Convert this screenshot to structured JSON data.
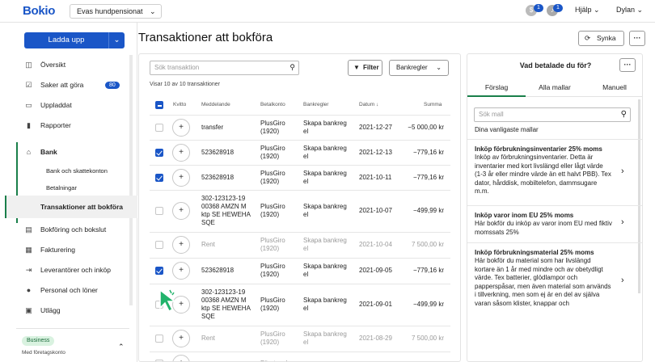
{
  "topbar": {
    "logo": "Bokio",
    "company": "Evas hundpensionat",
    "chev": "⌄",
    "badge1": "1",
    "badge2": "1",
    "help": "Hjälp ⌄",
    "user": "Dylan ⌄"
  },
  "sidebar": {
    "upload": "Ladda upp",
    "upload_chev": "⌄",
    "items": [
      {
        "label": "Översikt",
        "icon": "◫"
      },
      {
        "label": "Saker att göra",
        "icon": "☑",
        "count": "80"
      },
      {
        "label": "Uppladdat",
        "icon": "▭"
      },
      {
        "label": "Rapporter",
        "icon": "▮"
      },
      {
        "label": "Bank",
        "icon": "⌂"
      },
      {
        "label": "Bokföring och bokslut",
        "icon": "▤"
      },
      {
        "label": "Fakturering",
        "icon": "▦"
      },
      {
        "label": "Leverantörer och inköp",
        "icon": "⇥"
      },
      {
        "label": "Personal och löner",
        "icon": "●"
      },
      {
        "label": "Utlägg",
        "icon": "▣"
      }
    ],
    "bank_sub": [
      "Bank och skattekonton",
      "Betalningar",
      "Transaktioner att bokföra"
    ],
    "business": "Business",
    "business_sub": "Med företagskonto",
    "business_chev": "⌃"
  },
  "main": {
    "title": "Transaktioner att bokföra",
    "search_placeholder": "Sök transaktion",
    "filter": "Filter",
    "bankrules": "Bankregler",
    "count": "Visar 10 av 10 transaktioner",
    "headers": [
      "Kvitto",
      "Meddelande",
      "Betalkonto",
      "Bankregler",
      "Datum ↓",
      "Summa"
    ],
    "rows": [
      {
        "checked": false,
        "msg": [
          "transfer"
        ],
        "acct": [
          "PlusGiro",
          "(1920)"
        ],
        "rule": [
          "Skapa bankreg",
          "el"
        ],
        "date": "2021-12-27",
        "amt": "−5 000,00 kr",
        "dim": false
      },
      {
        "checked": true,
        "msg": [
          "523628918"
        ],
        "acct": [
          "PlusGiro",
          "(1920)"
        ],
        "rule": [
          "Skapa bankreg",
          "el"
        ],
        "date": "2021-12-13",
        "amt": "−779,16 kr",
        "dim": false
      },
      {
        "checked": true,
        "msg": [
          "523628918"
        ],
        "acct": [
          "PlusGiro",
          "(1920)"
        ],
        "rule": [
          "Skapa bankreg",
          "el"
        ],
        "date": "2021-10-11",
        "amt": "−779,16 kr",
        "dim": false
      },
      {
        "checked": false,
        "msg": [
          "302-123123-19",
          "00368 AMZN M",
          "ktp SE HEWEHA",
          "SQE"
        ],
        "acct": [
          "PlusGiro",
          "(1920)"
        ],
        "rule": [
          "Skapa bankreg",
          "el"
        ],
        "date": "2021-10-07",
        "amt": "−499,99 kr",
        "dim": false
      },
      {
        "checked": false,
        "msg": [
          "Rent"
        ],
        "acct": [
          "PlusGiro",
          "(1920)"
        ],
        "rule": [
          "Skapa bankreg",
          "el"
        ],
        "date": "2021-10-04",
        "amt": "7 500,00 kr",
        "dim": true
      },
      {
        "checked": true,
        "msg": [
          "523628918"
        ],
        "acct": [
          "PlusGiro",
          "(1920)"
        ],
        "rule": [
          "Skapa bankreg",
          "el"
        ],
        "date": "2021-09-05",
        "amt": "−779,16 kr",
        "dim": false
      },
      {
        "checked": false,
        "msg": [
          "302-123123-19",
          "00368 AMZN M",
          "ktp SE HEWEHA",
          "SQE"
        ],
        "acct": [
          "PlusGiro",
          "(1920)"
        ],
        "rule": [
          "Skapa bankreg",
          "el"
        ],
        "date": "2021-09-01",
        "amt": "−499,99 kr",
        "dim": false
      },
      {
        "checked": false,
        "msg": [
          "Rent"
        ],
        "acct": [
          "PlusGiro",
          "(1920)"
        ],
        "rule": [
          "Skapa bankreg",
          "el"
        ],
        "date": "2021-08-29",
        "amt": "7 500,00 kr",
        "dim": true
      },
      {
        "checked": false,
        "msg": [
          ""
        ],
        "acct": [
          "Företagsk"
        ],
        "rule": [
          ""
        ],
        "date": "",
        "amt": "",
        "dim": true
      }
    ],
    "plus": "+"
  },
  "right": {
    "title": "Vad betalade du för?",
    "more": "···",
    "tabs": [
      "Förslag",
      "Alla mallar",
      "Manuell"
    ],
    "search_placeholder": "Sök mall",
    "subtitle": "Dina vanligaste mallar",
    "templates": [
      {
        "title": "Inköp förbrukningsinventarier 25% moms",
        "desc": "Inköp av förbrukningsinventarier. Detta är inventarier med kort livslängd eller lågt värde (1-3 år eller mindre värde än ett halvt PBB). Tex dator, hårddisk, mobiltelefon, dammsugare m.m."
      },
      {
        "title": "Inköp varor inom EU 25% moms",
        "desc": "Här bokför du inköp av varor inom EU med fiktiv momssats 25%"
      },
      {
        "title": "Inköp förbrukningsmaterial 25% moms",
        "desc": "Här bokför du material som har livslängd kortare än 1 år med mindre och av obetydligt värde. Tex batterier, glödlampor och papperspåsar, men även material som används i tillverkning, men som ej är en del av själva varan såsom klister, knappar och"
      }
    ],
    "chev": "›"
  },
  "sync": "Synka",
  "sync_icon": "⟳",
  "more": "···",
  "colors": {
    "brand": "#1a56c7",
    "green": "#1a7f4a",
    "cursor": "#22b36b"
  }
}
